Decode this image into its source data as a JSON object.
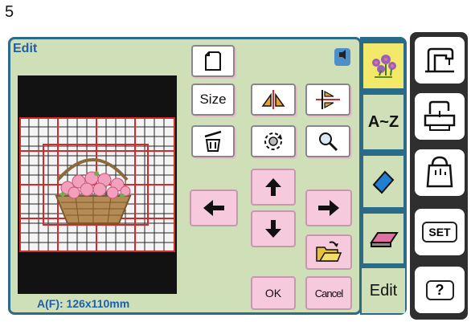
{
  "step_number": "5",
  "panel": {
    "title": "Edit"
  },
  "preview": {
    "size_label": "A(F): 126x110mm"
  },
  "buttons": {
    "size": "Size",
    "ok": "OK",
    "cancel": "Cancel"
  },
  "tabs": {
    "letters": "A~Z",
    "edit": "Edit"
  },
  "side_buttons": {
    "set": "SET",
    "help": "?"
  },
  "colors": {
    "lcd_background": "#cfe0b8",
    "frame_blue": "#2a6b8a",
    "title_blue": "#1f5fa8",
    "pink_button": "#f6c9dc",
    "grid_red": "#d62828",
    "selected_tab": "#f2e86a"
  },
  "icons": [
    "new-page-icon",
    "info-icon",
    "mirror-icon",
    "flip-icon",
    "delete-icon",
    "rotate-icon",
    "magnify-icon",
    "arrow-up-icon",
    "arrow-down-icon",
    "arrow-left-icon",
    "arrow-right-icon",
    "open-folder-icon",
    "flowers-pattern-icon",
    "eraser-icon",
    "sewing-machine-icon",
    "embroidery-machine-icon",
    "hand-bag-icon"
  ]
}
